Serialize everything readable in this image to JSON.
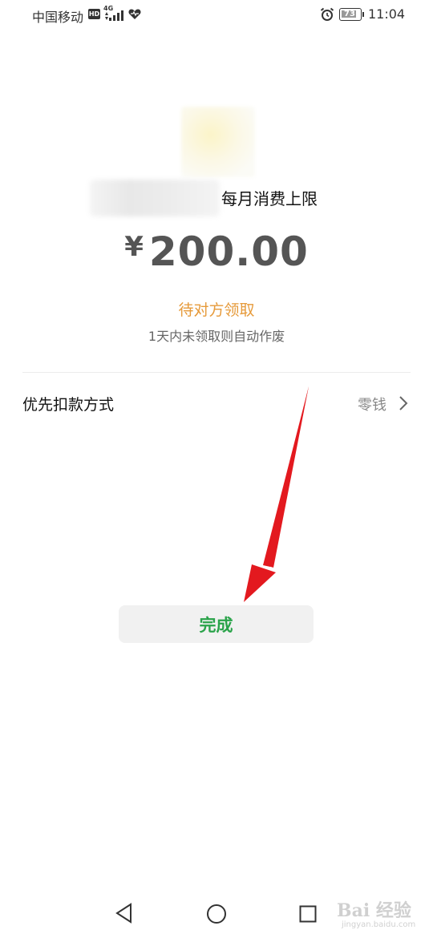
{
  "status_bar": {
    "carrier": "中国移动",
    "hd": "HD",
    "network": "4G",
    "battery": "73",
    "time": "11:04"
  },
  "main": {
    "limit_label": "每月消费上限",
    "currency": "¥",
    "amount": "200.00",
    "status": "待对方领取",
    "hint": "1天内未领取则自动作废",
    "payment_method_label": "优先扣款方式",
    "payment_method_value": "零钱",
    "done_button": "完成"
  },
  "watermark": {
    "text": "Bai 经验",
    "sub": "jingyan.baidu.com"
  },
  "colors": {
    "status_orange": "#e69a3a",
    "done_green": "#2aa34a",
    "annotation_red": "#e3191f"
  },
  "icons": {
    "back": "triangle-back-icon",
    "home": "circle-home-icon",
    "recent": "square-recent-icon",
    "chevron": "chevron-right-icon"
  }
}
